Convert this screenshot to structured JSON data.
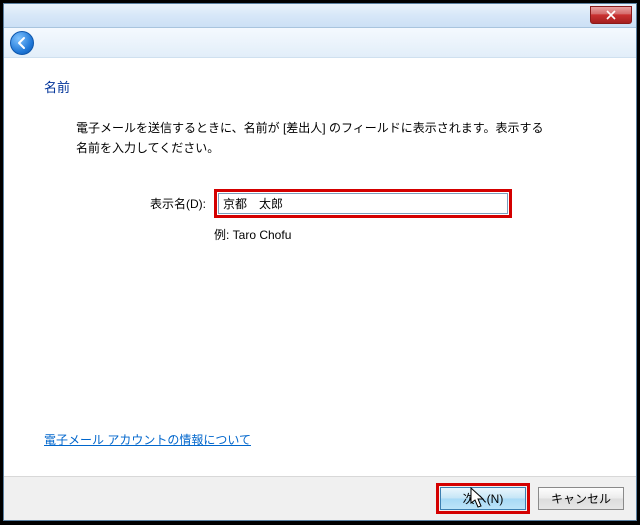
{
  "header": {
    "title": "名前"
  },
  "body": {
    "description": "電子メールを送信するときに、名前が [差出人] のフィールドに表示されます。表示する名前を入力してください。",
    "display_name_label": "表示名(D):",
    "display_name_value": "京都　太郎",
    "example_label": "例: Taro Chofu",
    "info_link": "電子メール アカウントの情報について"
  },
  "footer": {
    "next_label": "次へ(N)",
    "cancel_label": "キャンセル"
  }
}
